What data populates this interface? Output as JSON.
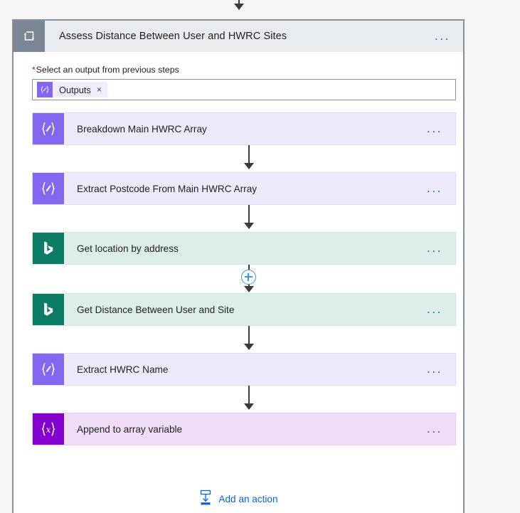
{
  "canvas": {
    "background_color": "#f5f5f5"
  },
  "top_connector": {
    "plus_icon": "plus-circle-icon",
    "accent_color": "#3a96dd"
  },
  "scope": {
    "icon": "foreach-loop-icon",
    "title": "Assess Distance Between User and HWRC Sites",
    "overflow_menu": "...",
    "header_bg": "#e8ecef",
    "icon_bg": "#7b8694",
    "border_color": "#8a8f99"
  },
  "field": {
    "required_marker": "*",
    "label": "Select an output from previous steps",
    "token": {
      "icon": "compose-token-icon",
      "glyph": "{∕}",
      "text": "Outputs",
      "remove_icon": "×",
      "icon_bg": "#8367f0"
    }
  },
  "actions": [
    {
      "id": "breakdown-main-hwrc-array",
      "title": "Breakdown Main HWRC Array",
      "type": "compose",
      "icon": "compose-icon",
      "glyph": "{∕}",
      "icon_bg": "#8367f0",
      "card_bg": "#eeeafc",
      "overflow_menu": "..."
    },
    {
      "id": "extract-postcode-from-main-hwrc-array",
      "title": "Extract Postcode From Main HWRC Array",
      "type": "compose",
      "icon": "compose-icon",
      "glyph": "{∕}",
      "icon_bg": "#8367f0",
      "card_bg": "#eeeafc",
      "overflow_menu": "..."
    },
    {
      "id": "get-location-by-address",
      "title": "Get location by address",
      "type": "bing-maps",
      "icon": "bing-maps-icon",
      "glyph": "",
      "icon_bg": "#0a7c67",
      "card_bg": "#ddeeea",
      "overflow_menu": "..."
    },
    {
      "id": "get-distance-between-user-and-site",
      "title": "Get Distance Between User and Site",
      "type": "bing-maps",
      "icon": "bing-maps-icon",
      "glyph": "",
      "icon_bg": "#0a7c67",
      "card_bg": "#ddeeea",
      "overflow_menu": "..."
    },
    {
      "id": "extract-hwrc-name",
      "title": "Extract HWRC Name",
      "type": "compose",
      "icon": "compose-icon",
      "glyph": "{∕}",
      "icon_bg": "#8367f0",
      "card_bg": "#eeeafc",
      "overflow_menu": "..."
    },
    {
      "id": "append-to-array-variable",
      "title": "Append to array variable",
      "type": "variable",
      "icon": "variable-icon",
      "glyph": "{x}",
      "icon_bg": "#8400cf",
      "card_bg": "#f0dcf7",
      "overflow_menu": "..."
    }
  ],
  "connectors": [
    {
      "after": "breakdown-main-hwrc-array",
      "has_plus": false
    },
    {
      "after": "extract-postcode-from-main-hwrc-array",
      "has_plus": false
    },
    {
      "after": "get-location-by-address",
      "has_plus": true
    },
    {
      "after": "get-distance-between-user-and-site",
      "has_plus": false
    },
    {
      "after": "extract-hwrc-name",
      "has_plus": false
    }
  ],
  "add_action": {
    "icon": "insert-action-icon",
    "label": "Add an action",
    "link_color": "#0a63c9"
  }
}
